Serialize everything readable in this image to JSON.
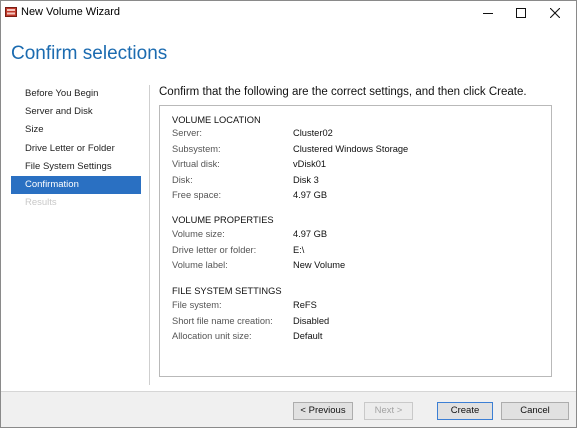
{
  "window": {
    "title": "New Volume Wizard"
  },
  "header": {
    "title": "Confirm selections"
  },
  "nav": {
    "items": [
      {
        "label": "Before You Begin"
      },
      {
        "label": "Server and Disk"
      },
      {
        "label": "Size"
      },
      {
        "label": "Drive Letter or Folder"
      },
      {
        "label": "File System Settings"
      },
      {
        "label": "Confirmation"
      },
      {
        "label": "Results"
      }
    ],
    "active": "Confirmation"
  },
  "content": {
    "instruction": "Confirm that the following are the correct settings, and then click Create.",
    "sections": [
      {
        "title": "VOLUME LOCATION",
        "rows": [
          {
            "key": "Server:",
            "value": "Cluster02"
          },
          {
            "key": "Subsystem:",
            "value": "Clustered Windows Storage"
          },
          {
            "key": "Virtual disk:",
            "value": "vDisk01"
          },
          {
            "key": "Disk:",
            "value": "Disk 3"
          },
          {
            "key": "Free space:",
            "value": "4.97 GB"
          }
        ]
      },
      {
        "title": "VOLUME PROPERTIES",
        "rows": [
          {
            "key": "Volume size:",
            "value": "4.97 GB"
          },
          {
            "key": "Drive letter or folder:",
            "value": "E:\\"
          },
          {
            "key": "Volume label:",
            "value": "New Volume"
          }
        ]
      },
      {
        "title": "FILE SYSTEM SETTINGS",
        "rows": [
          {
            "key": "File system:",
            "value": "ReFS"
          },
          {
            "key": "Short file name creation:",
            "value": "Disabled"
          },
          {
            "key": "Allocation unit size:",
            "value": "Default"
          }
        ]
      }
    ]
  },
  "buttons": {
    "previous": "< Previous",
    "next": "Next >",
    "create": "Create",
    "cancel": "Cancel"
  },
  "colors": {
    "accent": "#2a70c2",
    "title": "#1b6bb0"
  },
  "icons": {
    "app": "wizard-app-icon",
    "minimize": "minimize-icon",
    "maximize": "maximize-icon",
    "close": "close-icon"
  }
}
